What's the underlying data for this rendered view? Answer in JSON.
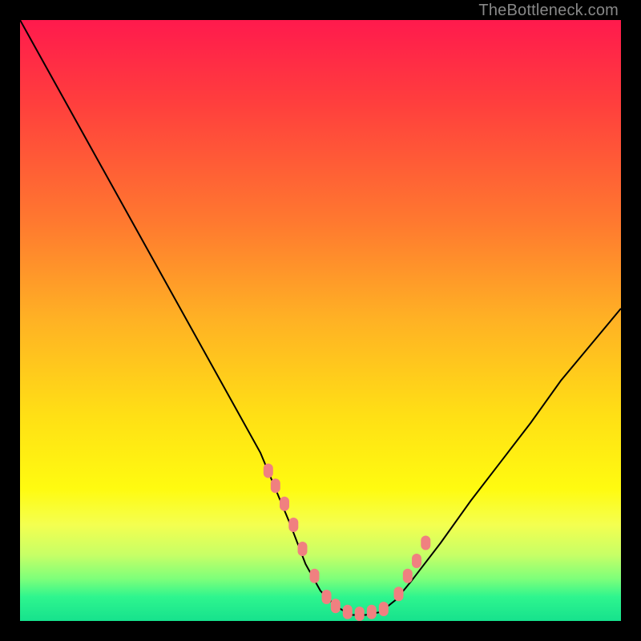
{
  "watermark": "TheBottleneck.com",
  "chart_data": {
    "type": "line",
    "title": "",
    "xlabel": "",
    "ylabel": "",
    "xlim": [
      0,
      1
    ],
    "ylim": [
      0,
      1
    ],
    "series": [
      {
        "name": "bottleneck-curve",
        "x": [
          0.0,
          0.05,
          0.1,
          0.15,
          0.2,
          0.25,
          0.3,
          0.35,
          0.4,
          0.45,
          0.475,
          0.5,
          0.525,
          0.55,
          0.575,
          0.6,
          0.625,
          0.65,
          0.7,
          0.75,
          0.8,
          0.85,
          0.9,
          0.95,
          1.0
        ],
        "values": [
          1.0,
          0.91,
          0.82,
          0.73,
          0.64,
          0.55,
          0.46,
          0.37,
          0.28,
          0.16,
          0.095,
          0.05,
          0.025,
          0.01,
          0.01,
          0.015,
          0.035,
          0.065,
          0.13,
          0.2,
          0.265,
          0.33,
          0.4,
          0.46,
          0.52
        ]
      }
    ],
    "highlight_points": {
      "comment": "salmon markers along the valley floor and arms",
      "color": "#f08080",
      "x": [
        0.413,
        0.425,
        0.44,
        0.455,
        0.47,
        0.49,
        0.51,
        0.525,
        0.545,
        0.565,
        0.585,
        0.605,
        0.63,
        0.645,
        0.66,
        0.675
      ],
      "values": [
        0.25,
        0.225,
        0.195,
        0.16,
        0.12,
        0.075,
        0.04,
        0.025,
        0.015,
        0.012,
        0.015,
        0.02,
        0.045,
        0.075,
        0.1,
        0.13
      ]
    }
  }
}
